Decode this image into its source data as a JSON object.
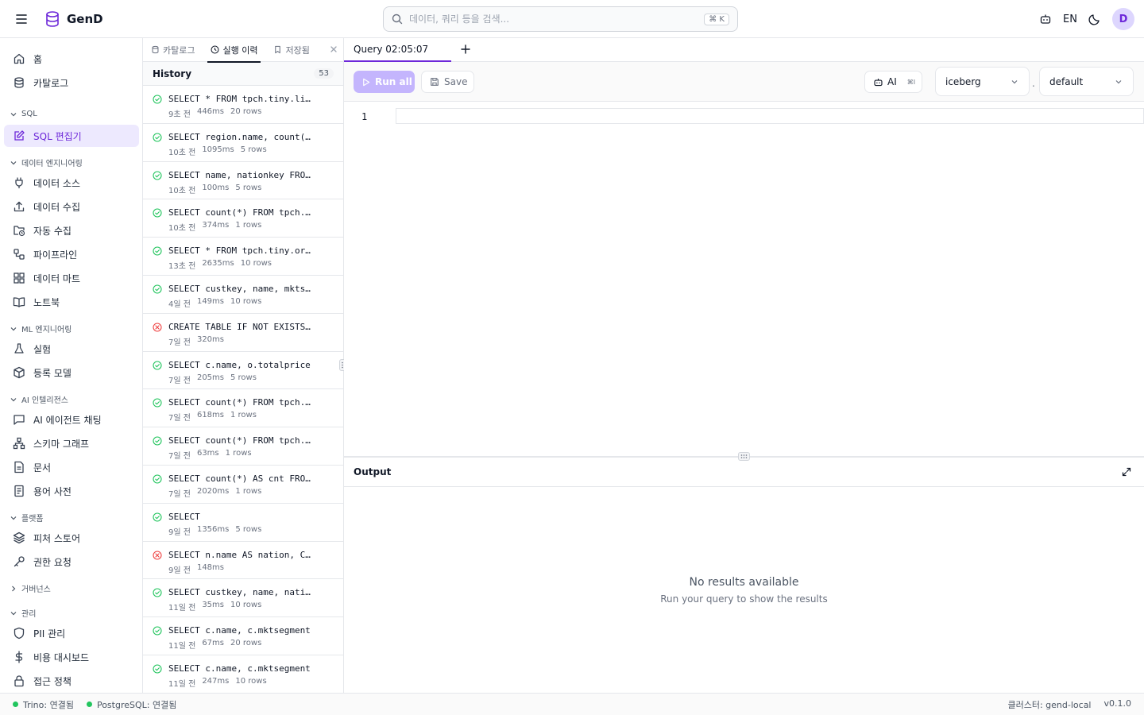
{
  "app": {
    "name": "GenD"
  },
  "search": {
    "placeholder": "데이터, 쿼리 등을 검색...",
    "shortcut": "⌘ K"
  },
  "header": {
    "lang": "EN",
    "avatar": "D"
  },
  "sidebar": {
    "top": [
      {
        "label": "홈"
      },
      {
        "label": "카탈로그"
      }
    ],
    "sections": [
      {
        "title": "SQL",
        "items": [
          {
            "label": "SQL 편집기",
            "active": true
          }
        ]
      },
      {
        "title": "데이터 엔지니어링",
        "items": [
          {
            "label": "데이터 소스"
          },
          {
            "label": "데이터 수집"
          },
          {
            "label": "자동 수집"
          },
          {
            "label": "파이프라인"
          },
          {
            "label": "데이터 마트"
          },
          {
            "label": "노트북"
          }
        ]
      },
      {
        "title": "ML 엔지니어링",
        "items": [
          {
            "label": "실험"
          },
          {
            "label": "등록 모델"
          }
        ]
      },
      {
        "title": "AI 인텔리전스",
        "items": [
          {
            "label": "AI 에이전트 채팅"
          },
          {
            "label": "스키마 그래프"
          },
          {
            "label": "문서"
          },
          {
            "label": "용어 사전"
          }
        ]
      },
      {
        "title": "플랫폼",
        "items": [
          {
            "label": "피처 스토어"
          },
          {
            "label": "권한 요청"
          }
        ]
      },
      {
        "title": "거버넌스",
        "items": []
      },
      {
        "title": "관리",
        "items": [
          {
            "label": "PII 관리"
          },
          {
            "label": "비용 대시보드"
          },
          {
            "label": "접근 정책"
          }
        ]
      }
    ]
  },
  "history_panel": {
    "tabs": [
      {
        "label": "카탈로그"
      },
      {
        "label": "실행 이력",
        "active": true
      },
      {
        "label": "저장됨"
      }
    ],
    "title": "History",
    "count": "53",
    "items": [
      {
        "query": "SELECT * FROM tpch.tiny.lineitem",
        "time": "9초 전",
        "duration": "446ms",
        "rows": "20 rows",
        "status": "success"
      },
      {
        "query": "SELECT region.name, count(*)",
        "time": "10초 전",
        "duration": "1095ms",
        "rows": "5 rows",
        "status": "success"
      },
      {
        "query": "SELECT name, nationkey FROM nation",
        "time": "10초 전",
        "duration": "100ms",
        "rows": "5 rows",
        "status": "success"
      },
      {
        "query": "SELECT count(*) FROM tpch.tiny",
        "time": "10초 전",
        "duration": "374ms",
        "rows": "1 rows",
        "status": "success"
      },
      {
        "query": "SELECT * FROM tpch.tiny.orders",
        "time": "13초 전",
        "duration": "2635ms",
        "rows": "10 rows",
        "status": "success"
      },
      {
        "query": "SELECT custkey, name, mktsegment",
        "time": "4일 전",
        "duration": "149ms",
        "rows": "10 rows",
        "status": "success"
      },
      {
        "query": "CREATE TABLE IF NOT EXISTS iceberg",
        "time": "7일 전",
        "duration": "320ms",
        "rows": "",
        "status": "error"
      },
      {
        "query": "SELECT c.name, o.totalprice",
        "time": "7일 전",
        "duration": "205ms",
        "rows": "5 rows",
        "status": "success"
      },
      {
        "query": "SELECT count(*) FROM tpch.tiny",
        "time": "7일 전",
        "duration": "618ms",
        "rows": "1 rows",
        "status": "success"
      },
      {
        "query": "SELECT count(*) FROM tpch.tiny",
        "time": "7일 전",
        "duration": "63ms",
        "rows": "1 rows",
        "status": "success"
      },
      {
        "query": "SELECT count(*) AS cnt FROM tpch",
        "time": "7일 전",
        "duration": "2020ms",
        "rows": "1 rows",
        "status": "success"
      },
      {
        "query": "SELECT",
        "time": "9일 전",
        "duration": "1356ms",
        "rows": "5 rows",
        "status": "success"
      },
      {
        "query": "SELECT n.name AS nation, COUNT",
        "time": "9일 전",
        "duration": "148ms",
        "rows": "",
        "status": "error"
      },
      {
        "query": "SELECT custkey, name, nationkey",
        "time": "11일 전",
        "duration": "35ms",
        "rows": "10 rows",
        "status": "success"
      },
      {
        "query": "SELECT c.name, c.mktsegment",
        "time": "11일 전",
        "duration": "67ms",
        "rows": "20 rows",
        "status": "success"
      },
      {
        "query": "SELECT c.name, c.mktsegment",
        "time": "11일 전",
        "duration": "247ms",
        "rows": "10 rows",
        "status": "success"
      }
    ]
  },
  "editor": {
    "tab_title": "Query 02:05:07",
    "run_label": "Run all",
    "save_label": "Save",
    "ai_label": "AI",
    "ai_shortcut": "⌘I",
    "catalog": "iceberg",
    "schema": "default",
    "line_number": "1"
  },
  "output": {
    "title": "Output",
    "empty_title": "No results available",
    "empty_subtitle": "Run your query to show the results"
  },
  "status_bar": {
    "trino": "Trino: 연결됨",
    "postgres": "PostgreSQL: 연결됨",
    "cluster": "클러스터: gend-local",
    "version": "v0.1.0"
  },
  "colors": {
    "accent": "#6d28d9",
    "accent_light": "#ede9fe",
    "success": "#22c55e",
    "error": "#ef4444"
  }
}
